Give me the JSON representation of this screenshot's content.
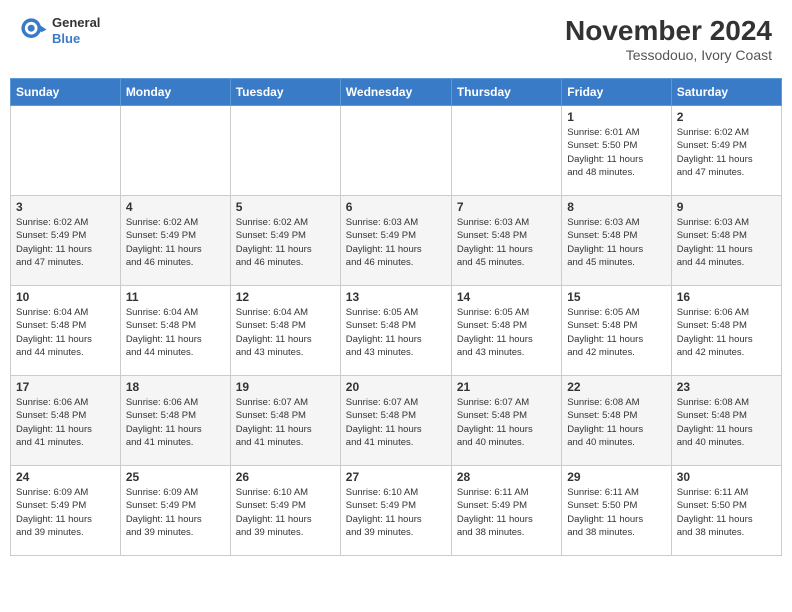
{
  "header": {
    "logo_line1": "General",
    "logo_line2": "Blue",
    "title": "November 2024",
    "subtitle": "Tessodouo, Ivory Coast"
  },
  "days_of_week": [
    "Sunday",
    "Monday",
    "Tuesday",
    "Wednesday",
    "Thursday",
    "Friday",
    "Saturday"
  ],
  "weeks": [
    [
      {
        "day": "",
        "info": ""
      },
      {
        "day": "",
        "info": ""
      },
      {
        "day": "",
        "info": ""
      },
      {
        "day": "",
        "info": ""
      },
      {
        "day": "",
        "info": ""
      },
      {
        "day": "1",
        "info": "Sunrise: 6:01 AM\nSunset: 5:50 PM\nDaylight: 11 hours\nand 48 minutes."
      },
      {
        "day": "2",
        "info": "Sunrise: 6:02 AM\nSunset: 5:49 PM\nDaylight: 11 hours\nand 47 minutes."
      }
    ],
    [
      {
        "day": "3",
        "info": "Sunrise: 6:02 AM\nSunset: 5:49 PM\nDaylight: 11 hours\nand 47 minutes."
      },
      {
        "day": "4",
        "info": "Sunrise: 6:02 AM\nSunset: 5:49 PM\nDaylight: 11 hours\nand 46 minutes."
      },
      {
        "day": "5",
        "info": "Sunrise: 6:02 AM\nSunset: 5:49 PM\nDaylight: 11 hours\nand 46 minutes."
      },
      {
        "day": "6",
        "info": "Sunrise: 6:03 AM\nSunset: 5:49 PM\nDaylight: 11 hours\nand 46 minutes."
      },
      {
        "day": "7",
        "info": "Sunrise: 6:03 AM\nSunset: 5:48 PM\nDaylight: 11 hours\nand 45 minutes."
      },
      {
        "day": "8",
        "info": "Sunrise: 6:03 AM\nSunset: 5:48 PM\nDaylight: 11 hours\nand 45 minutes."
      },
      {
        "day": "9",
        "info": "Sunrise: 6:03 AM\nSunset: 5:48 PM\nDaylight: 11 hours\nand 44 minutes."
      }
    ],
    [
      {
        "day": "10",
        "info": "Sunrise: 6:04 AM\nSunset: 5:48 PM\nDaylight: 11 hours\nand 44 minutes."
      },
      {
        "day": "11",
        "info": "Sunrise: 6:04 AM\nSunset: 5:48 PM\nDaylight: 11 hours\nand 44 minutes."
      },
      {
        "day": "12",
        "info": "Sunrise: 6:04 AM\nSunset: 5:48 PM\nDaylight: 11 hours\nand 43 minutes."
      },
      {
        "day": "13",
        "info": "Sunrise: 6:05 AM\nSunset: 5:48 PM\nDaylight: 11 hours\nand 43 minutes."
      },
      {
        "day": "14",
        "info": "Sunrise: 6:05 AM\nSunset: 5:48 PM\nDaylight: 11 hours\nand 43 minutes."
      },
      {
        "day": "15",
        "info": "Sunrise: 6:05 AM\nSunset: 5:48 PM\nDaylight: 11 hours\nand 42 minutes."
      },
      {
        "day": "16",
        "info": "Sunrise: 6:06 AM\nSunset: 5:48 PM\nDaylight: 11 hours\nand 42 minutes."
      }
    ],
    [
      {
        "day": "17",
        "info": "Sunrise: 6:06 AM\nSunset: 5:48 PM\nDaylight: 11 hours\nand 41 minutes."
      },
      {
        "day": "18",
        "info": "Sunrise: 6:06 AM\nSunset: 5:48 PM\nDaylight: 11 hours\nand 41 minutes."
      },
      {
        "day": "19",
        "info": "Sunrise: 6:07 AM\nSunset: 5:48 PM\nDaylight: 11 hours\nand 41 minutes."
      },
      {
        "day": "20",
        "info": "Sunrise: 6:07 AM\nSunset: 5:48 PM\nDaylight: 11 hours\nand 41 minutes."
      },
      {
        "day": "21",
        "info": "Sunrise: 6:07 AM\nSunset: 5:48 PM\nDaylight: 11 hours\nand 40 minutes."
      },
      {
        "day": "22",
        "info": "Sunrise: 6:08 AM\nSunset: 5:48 PM\nDaylight: 11 hours\nand 40 minutes."
      },
      {
        "day": "23",
        "info": "Sunrise: 6:08 AM\nSunset: 5:48 PM\nDaylight: 11 hours\nand 40 minutes."
      }
    ],
    [
      {
        "day": "24",
        "info": "Sunrise: 6:09 AM\nSunset: 5:49 PM\nDaylight: 11 hours\nand 39 minutes."
      },
      {
        "day": "25",
        "info": "Sunrise: 6:09 AM\nSunset: 5:49 PM\nDaylight: 11 hours\nand 39 minutes."
      },
      {
        "day": "26",
        "info": "Sunrise: 6:10 AM\nSunset: 5:49 PM\nDaylight: 11 hours\nand 39 minutes."
      },
      {
        "day": "27",
        "info": "Sunrise: 6:10 AM\nSunset: 5:49 PM\nDaylight: 11 hours\nand 39 minutes."
      },
      {
        "day": "28",
        "info": "Sunrise: 6:11 AM\nSunset: 5:49 PM\nDaylight: 11 hours\nand 38 minutes."
      },
      {
        "day": "29",
        "info": "Sunrise: 6:11 AM\nSunset: 5:50 PM\nDaylight: 11 hours\nand 38 minutes."
      },
      {
        "day": "30",
        "info": "Sunrise: 6:11 AM\nSunset: 5:50 PM\nDaylight: 11 hours\nand 38 minutes."
      }
    ]
  ]
}
